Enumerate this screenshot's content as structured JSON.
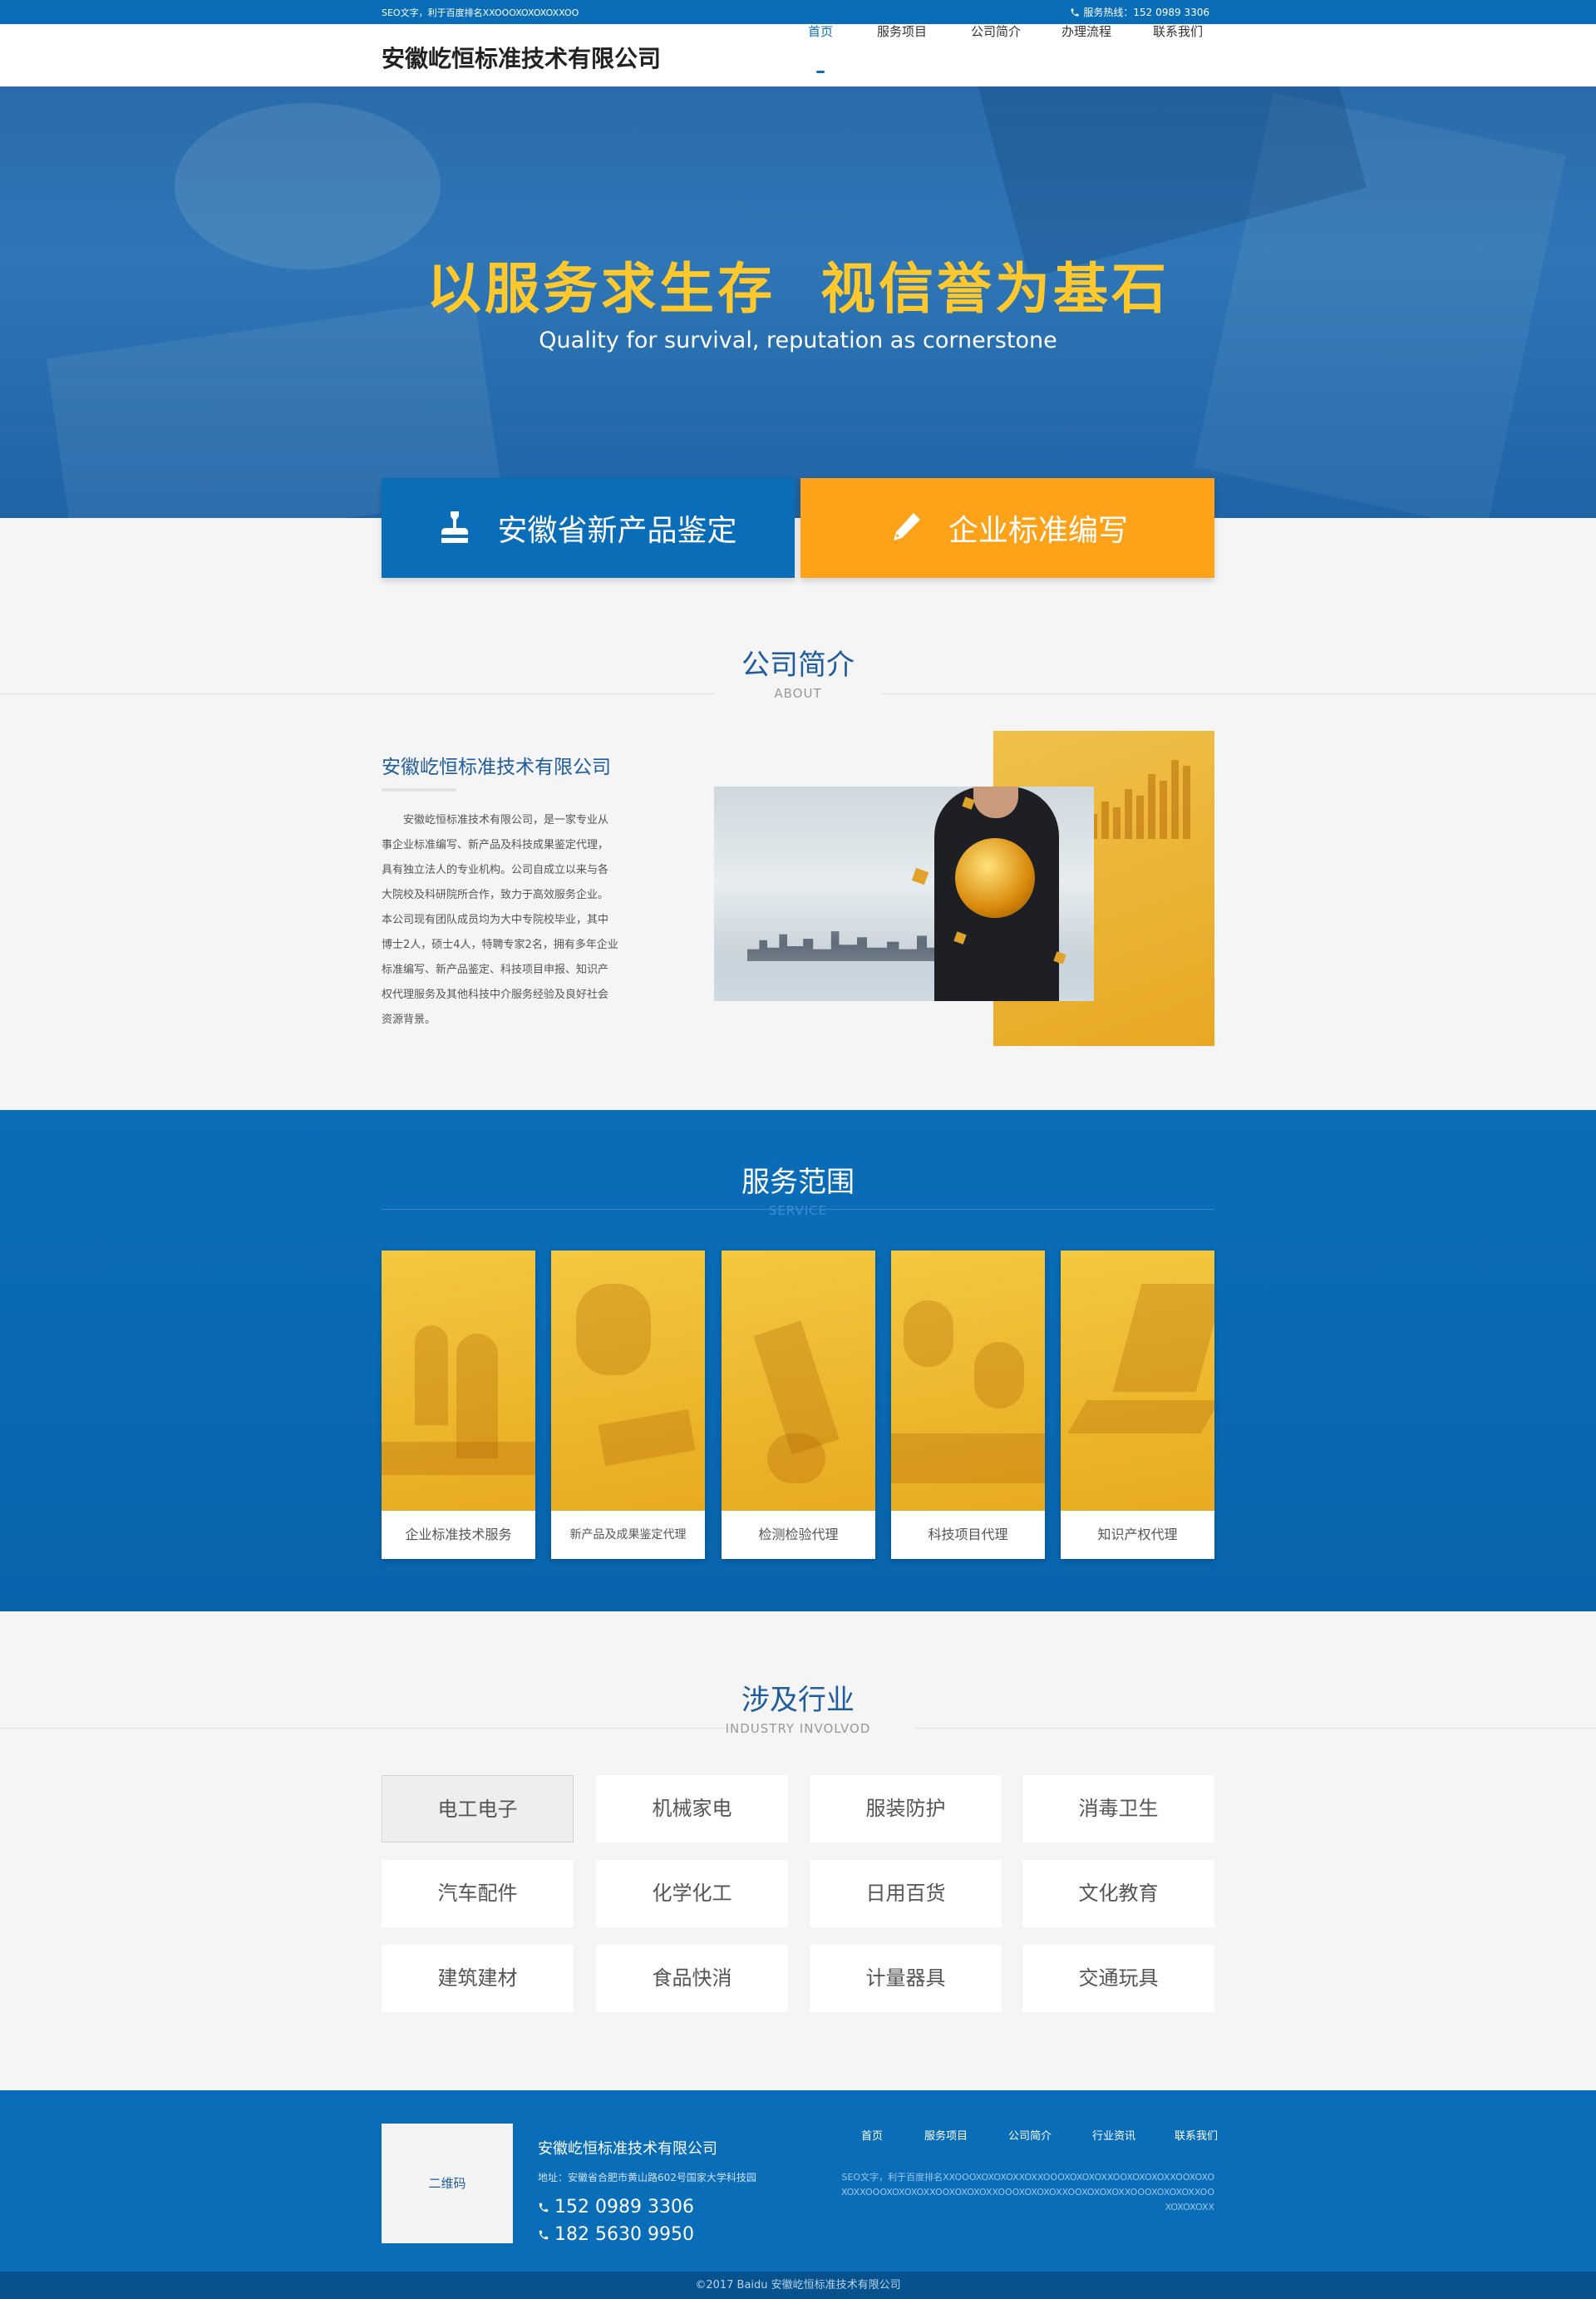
{
  "topbar": {
    "seo_text": "SEO文字，利于百度排名XXOOOXOXOXOXXOO",
    "hotline": "服务热线：152 0989 3306"
  },
  "header": {
    "logo": "安徽屹恒标准技术有限公司",
    "nav": [
      "首页",
      "服务项目",
      "公司简介",
      "办理流程",
      "联系我们"
    ],
    "active_nav": "首页"
  },
  "banner": {
    "slogan": "以服务求生存  视信誉为基石",
    "subtitle": "Quality for survival, reputation as cornerstone"
  },
  "big_buttons": {
    "left": {
      "label": "安徽省新产品鉴定",
      "icon": "stamp-icon",
      "color": "#0a6db8"
    },
    "right": {
      "label": "企业标准编写",
      "icon": "pencil-icon",
      "color": "#fea21a"
    }
  },
  "about": {
    "title_cn": "公司简介",
    "title_en": "ABOUT",
    "company_name": "安徽屹恒标准技术有限公司",
    "description": "安徽屹恒标准技术有限公司，是一家专业从事企业标准编写、新产品及科技成果鉴定代理，具有独立法人的专业机构。公司自成立以来与各大院校及科研院所合作，致力于高效服务企业。本公司现有团队成员均为大中专院校毕业，其中博士2人，硕士4人，特聘专家2名，拥有多年企业标准编写、新产品鉴定、科技项目申报、知识产权代理服务及其他科技中介服务经验及良好社会资源背景。"
  },
  "service": {
    "title_cn": "服务范围",
    "title_en": "SERVICE",
    "items": [
      "企业标准技术服务",
      "新产品及成果鉴定代理",
      "检测检验代理",
      "科技项目代理",
      "知识产权代理"
    ]
  },
  "industry": {
    "title_cn": "涉及行业",
    "title_en": "INDUSTRY INVOLVOD",
    "items": [
      "电工电子",
      "机械家电",
      "服装防护",
      "消毒卫生",
      "汽车配件",
      "化学化工",
      "日用百货",
      "文化教育",
      "建筑建材",
      "食品快消",
      "计量器具",
      "交通玩具"
    ],
    "active": "电工电子"
  },
  "footer": {
    "qr_label": "二维码",
    "company_name": "安徽屹恒标准技术有限公司",
    "address": "地址：安徽省合肥市黄山路602号国家大学科技园",
    "phones": [
      "152 0989 3306",
      "182 5630 9950"
    ],
    "nav": [
      "首页",
      "服务项目",
      "公司简介",
      "行业资讯",
      "联系我们"
    ],
    "seo_text": "SEO文字，利于百度排名XXOOOXOXOXOXXOXXOOOXOXOXOXXOOXOXOXOXXOOXOXOXOXXOOOXOXOXOXXOOXOXOXOXXOOOXOXOXOXXOOXOXOXOXXOOOXOXOXOXXOOXOXOXOXX",
    "copyright": "©2017 Baidu 安徽屹恒标准技术有限公司"
  }
}
